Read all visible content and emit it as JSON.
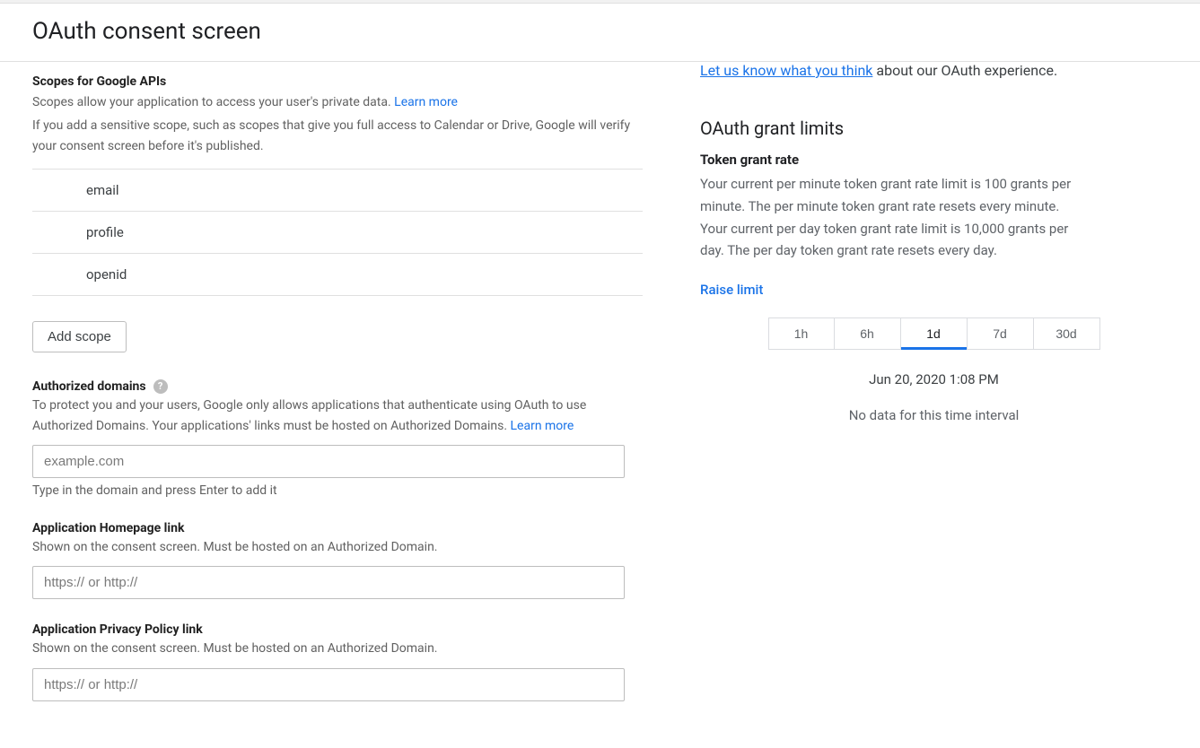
{
  "header": {
    "title": "OAuth consent screen"
  },
  "scopes": {
    "heading": "Scopes for Google APIs",
    "desc": "Scopes allow your application to access your user's private data. ",
    "learn_more": "Learn more",
    "note": "If you add a sensitive scope, such as scopes that give you full access to Calendar or Drive, Google will verify your consent screen before it's published.",
    "items": [
      "email",
      "profile",
      "openid"
    ],
    "add_button": "Add scope"
  },
  "authorized_domains": {
    "heading": "Authorized domains",
    "desc": "To protect you and your users, Google only allows applications that authenticate using OAuth to use Authorized Domains. Your applications' links must be hosted on Authorized Domains. ",
    "learn_more": "Learn more",
    "placeholder": "example.com",
    "hint": "Type in the domain and press Enter to add it"
  },
  "homepage": {
    "heading": "Application Homepage link",
    "desc": "Shown on the consent screen. Must be hosted on an Authorized Domain.",
    "placeholder": "https:// or http://"
  },
  "privacy": {
    "heading": "Application Privacy Policy link",
    "desc": "Shown on the consent screen. Must be hosted on an Authorized Domain.",
    "placeholder": "https:// or http://"
  },
  "feedback": {
    "link": "Let us know what you think",
    "rest": " about our OAuth experience."
  },
  "grant": {
    "heading": "OAuth grant limits",
    "subheading": "Token grant rate",
    "text": "Your current per minute token grant rate limit is 100 grants per minute. The per minute token grant rate resets every minute. Your current per day token grant rate limit is 10,000 grants per day. The per day token grant rate resets every day.",
    "raise": "Raise limit",
    "ranges": [
      "1h",
      "6h",
      "1d",
      "7d",
      "30d"
    ],
    "active_index": 2,
    "timestamp": "Jun 20, 2020 1:08 PM",
    "nodata": "No data for this time interval"
  }
}
